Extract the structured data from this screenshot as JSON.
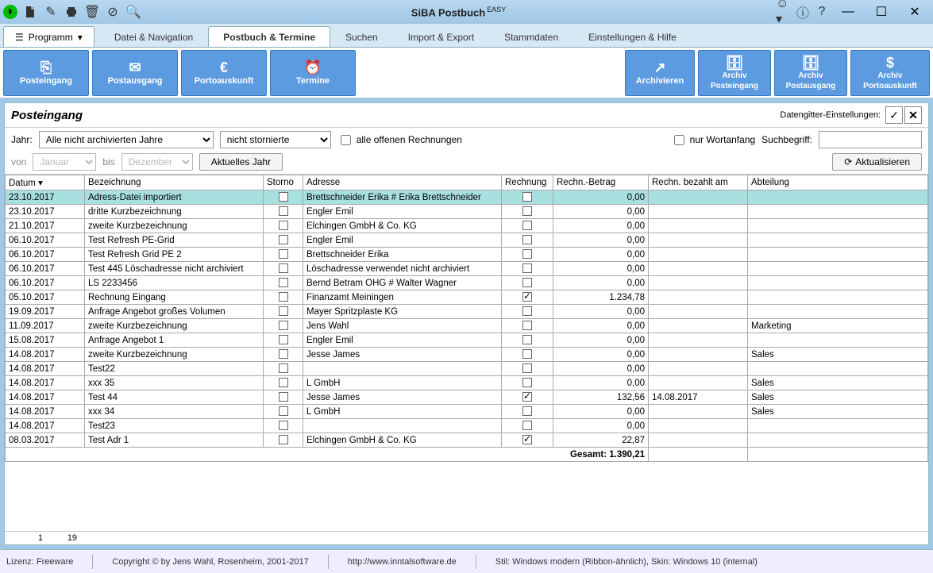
{
  "title": {
    "app": "SiBA Postbuch",
    "edition": "EASY"
  },
  "menu_btn": "Programm",
  "tabs": [
    "Datei & Navigation",
    "Postbuch & Termine",
    "Suchen",
    "Import & Export",
    "Stammdaten",
    "Einstellungen & Hilfe"
  ],
  "active_tab": 1,
  "ribbon": {
    "posteingang": "Posteingang",
    "postausgang": "Postausgang",
    "porto": "Portoauskunft",
    "termine": "Termine",
    "archivieren": "Archivieren",
    "archiv_pe_pre": "Archiv",
    "archiv_pe": "Posteingang",
    "archiv_pa_pre": "Archiv",
    "archiv_pa": "Postausgang",
    "archiv_po_pre": "Archiv",
    "archiv_po": "Portoauskunft"
  },
  "section_title": "Posteingang",
  "grid_settings_label": "Datengitter-Einstellungen:",
  "filters": {
    "jahr_label": "Jahr:",
    "jahr_value": "Alle nicht archivierten Jahre",
    "storno_value": "nicht stornierte",
    "alle_offen": "alle offenen Rechnungen",
    "von": "von",
    "bis": "bis",
    "mon_from": "Januar",
    "mon_to": "Dezember",
    "aktuelles": "Aktuelles Jahr",
    "wortanfang": "nur Wortanfang",
    "such_label": "Suchbegriff:",
    "such_value": "",
    "aktualisieren": "Aktualisieren"
  },
  "columns": {
    "datum": "Datum",
    "bez": "Bezeichnung",
    "storno": "Storno",
    "adresse": "Adresse",
    "rechnung": "Rechnung",
    "betrag": "Rechn.-Betrag",
    "bezahlt": "Rechn. bezahlt am",
    "abt": "Abteilung"
  },
  "rows": [
    {
      "d": "23.10.2017",
      "b": "Adress-Datei importiert",
      "s": false,
      "a": "Brettschneider Erika # Erika Brettschneider",
      "r": false,
      "bt": "0,00",
      "bz": "",
      "ab": "",
      "sel": true
    },
    {
      "d": "23.10.2017",
      "b": "dritte Kurzbezeichnung",
      "s": false,
      "a": "Engler Emil",
      "r": false,
      "bt": "0,00",
      "bz": "",
      "ab": ""
    },
    {
      "d": "21.10.2017",
      "b": "zweite Kurzbezeichnung",
      "s": false,
      "a": "Elchingen GmbH & Co. KG",
      "r": false,
      "bt": "0,00",
      "bz": "",
      "ab": ""
    },
    {
      "d": "06.10.2017",
      "b": "Test Refresh PE-Grid",
      "s": false,
      "a": "Engler Emil",
      "r": false,
      "bt": "0,00",
      "bz": "",
      "ab": ""
    },
    {
      "d": "06.10.2017",
      "b": "Test Refresh Grid PE 2",
      "s": false,
      "a": "Brettschneider Erika",
      "r": false,
      "bt": "0,00",
      "bz": "",
      "ab": ""
    },
    {
      "d": "06.10.2017",
      "b": "Test 445 Löschadresse nicht archiviert",
      "s": false,
      "a": "Löschadresse verwendet nicht archiviert",
      "r": false,
      "bt": "0,00",
      "bz": "",
      "ab": ""
    },
    {
      "d": "06.10.2017",
      "b": "LS 2233456",
      "s": false,
      "a": "Bernd Betram OHG # Walter Wagner",
      "r": false,
      "bt": "0,00",
      "bz": "",
      "ab": ""
    },
    {
      "d": "05.10.2017",
      "b": "Rechnung Eingang",
      "s": false,
      "a": "Finanzamt Meiningen",
      "r": true,
      "bt": "1.234,78",
      "bz": "",
      "ab": ""
    },
    {
      "d": "19.09.2017",
      "b": "Anfrage Angebot großes Volumen",
      "s": false,
      "a": "Mayer Spritzplaste KG",
      "r": false,
      "bt": "0,00",
      "bz": "",
      "ab": ""
    },
    {
      "d": "11.09.2017",
      "b": "zweite Kurzbezeichnung",
      "s": false,
      "a": "Jens Wahl",
      "r": false,
      "bt": "0,00",
      "bz": "",
      "ab": "Marketing"
    },
    {
      "d": "15.08.2017",
      "b": "Anfrage Angebot 1",
      "s": false,
      "a": "Engler Emil",
      "r": false,
      "bt": "0,00",
      "bz": "",
      "ab": ""
    },
    {
      "d": "14.08.2017",
      "b": "zweite Kurzbezeichnung",
      "s": false,
      "a": "Jesse James",
      "r": false,
      "bt": "0,00",
      "bz": "",
      "ab": "Sales"
    },
    {
      "d": "14.08.2017",
      "b": "Test22",
      "s": false,
      "a": "",
      "r": false,
      "bt": "0,00",
      "bz": "",
      "ab": ""
    },
    {
      "d": "14.08.2017",
      "b": "xxx 35",
      "s": false,
      "a": "L GmbH",
      "r": false,
      "bt": "0,00",
      "bz": "",
      "ab": "Sales"
    },
    {
      "d": "14.08.2017",
      "b": "Test 44",
      "s": false,
      "a": "Jesse James",
      "r": true,
      "bt": "132,56",
      "bz": "14.08.2017",
      "ab": "Sales"
    },
    {
      "d": "14.08.2017",
      "b": "xxx 34",
      "s": false,
      "a": "L GmbH",
      "r": false,
      "bt": "0,00",
      "bz": "",
      "ab": "Sales"
    },
    {
      "d": "14.08.2017",
      "b": "Test23",
      "s": false,
      "a": "",
      "r": false,
      "bt": "0,00",
      "bz": "",
      "ab": ""
    },
    {
      "d": "08.03.2017",
      "b": "Test Adr 1",
      "s": false,
      "a": "Elchingen GmbH & Co. KG",
      "r": true,
      "bt": "22,87",
      "bz": "",
      "ab": ""
    }
  ],
  "sum_label": "Gesamt: 1.390,21",
  "pager": {
    "cur": "1",
    "total": "19"
  },
  "status": {
    "lic": "Lizenz: Freeware",
    "copy": "Copyright © by Jens Wahl, Rosenheim, 2001-2017",
    "url": "http://www.inntalsoftware.de",
    "skin": "Stil: Windows modern (Ribbon-ähnlich), Skin: Windows 10 (internal)"
  }
}
